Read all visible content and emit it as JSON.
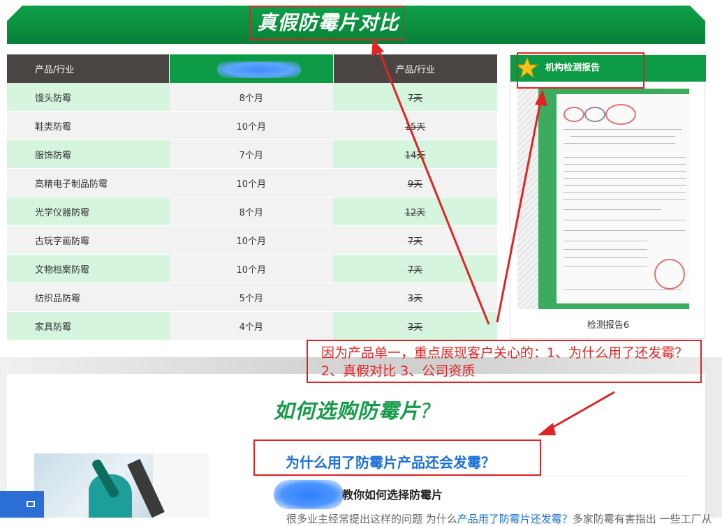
{
  "banner": {
    "title": "真假防霉片对比"
  },
  "table": {
    "headers": [
      "产品/行业",
      "",
      "产品/行业"
    ],
    "rows": [
      {
        "industry": "馒头防霉",
        "ours": "8个月",
        "fake": "7天"
      },
      {
        "industry": "鞋类防霉",
        "ours": "10个月",
        "fake": "15天"
      },
      {
        "industry": "服饰防霉",
        "ours": "7个月",
        "fake": "14天"
      },
      {
        "industry": "高精电子制品防霉",
        "ours": "10个月",
        "fake": "9天"
      },
      {
        "industry": "光学仪器防霉",
        "ours": "8个月",
        "fake": "12天"
      },
      {
        "industry": "古玩字画防霉",
        "ours": "10个月",
        "fake": "7天"
      },
      {
        "industry": "文物档案防霉",
        "ours": "10个月",
        "fake": "7天"
      },
      {
        "industry": "纺织品防霉",
        "ours": "5个月",
        "fake": "3天"
      },
      {
        "industry": "家具防霉",
        "ours": "4个月",
        "fake": "3天"
      }
    ]
  },
  "report": {
    "title": "机构检测报告",
    "caption": "检测报告6",
    "star_icon": "star-icon"
  },
  "annotation": {
    "text": "因为产品单一，重点展现客户关心的：1、为什么用了还发霉？ 2、真假对比 3、公司资质"
  },
  "lower": {
    "how_title": "如何选购防霉片",
    "how_q": "?",
    "why_title": "为什么用了防霉片产品还会发霉？",
    "teach_title": "教你如何选择防霉片",
    "cutoff_text": "很多业主经常提出这样的问题  为什么",
    "cutoff_link": "产品用了防霉片还发霉？",
    "cutoff_text2": "多家防霉有害指出  一些工厂从"
  },
  "colors": {
    "green": "#0c9a44",
    "dark_header": "#4a4543",
    "light_green_row": "#d6f5df",
    "annotation_red": "#e02424",
    "link_blue": "#1a6fd6"
  }
}
